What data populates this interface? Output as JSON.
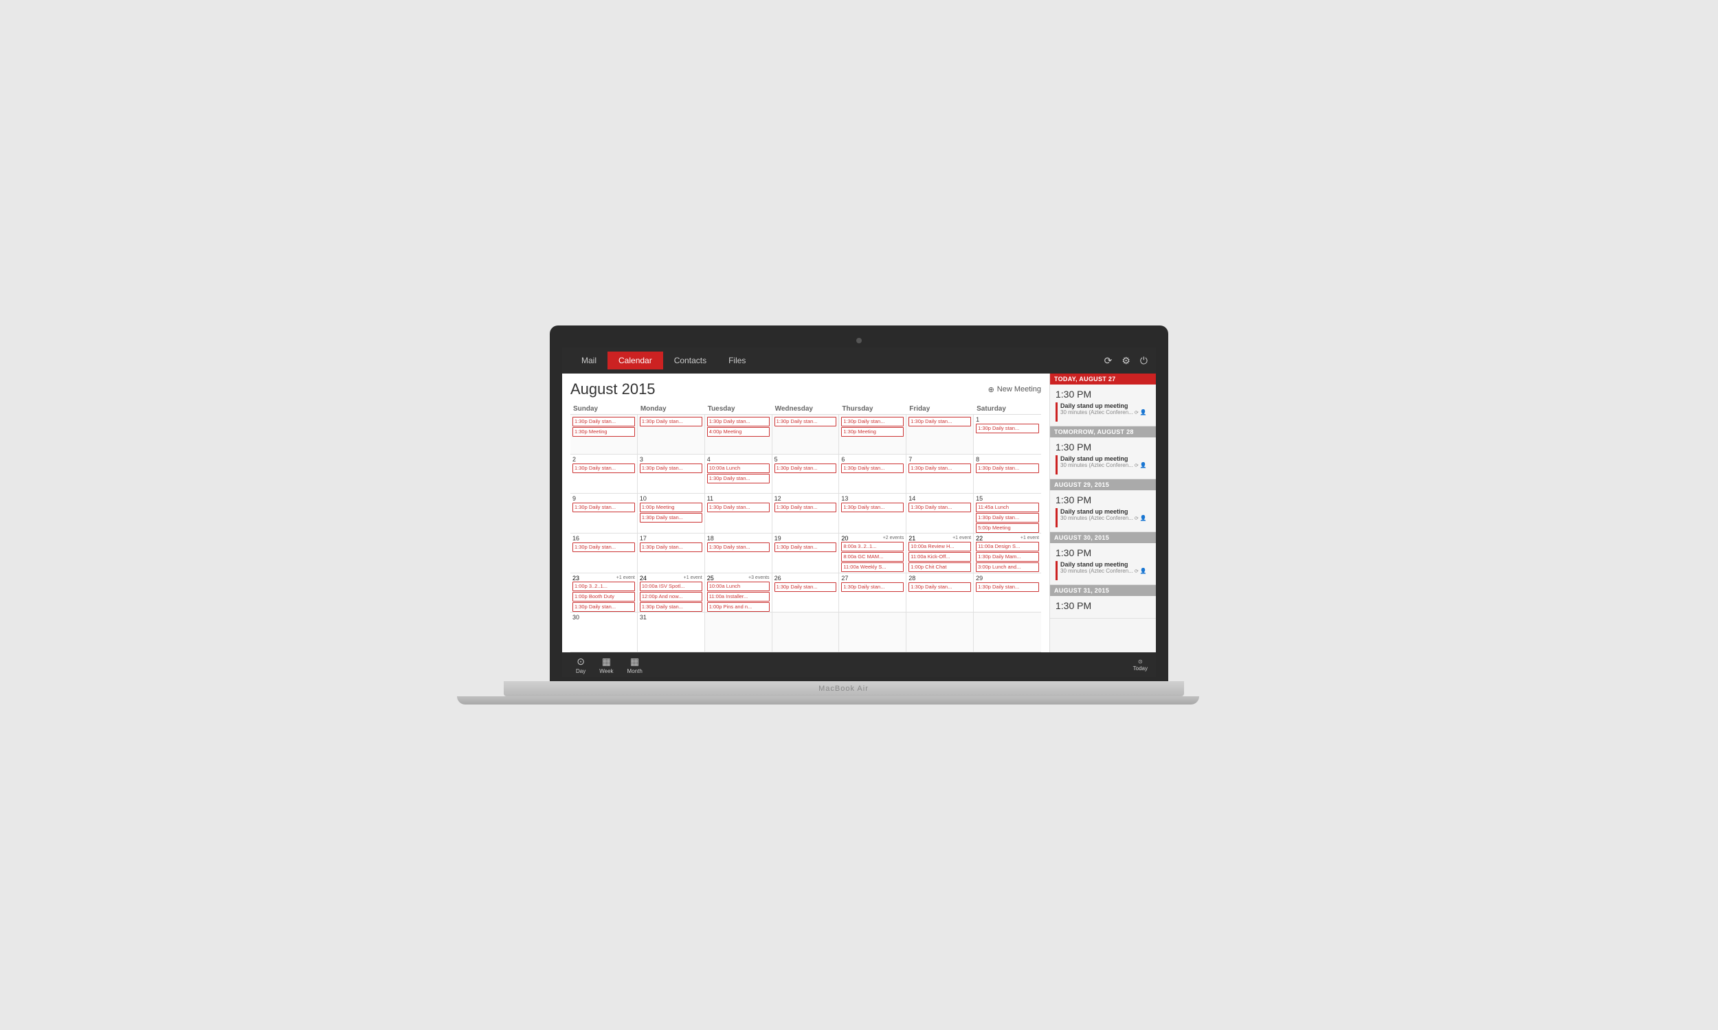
{
  "app": {
    "title": "MacBook Air"
  },
  "nav": {
    "tabs": [
      "Mail",
      "Calendar",
      "Contacts",
      "Files"
    ],
    "active_tab": "Calendar",
    "icons": [
      "refresh",
      "settings",
      "power"
    ]
  },
  "calendar": {
    "title": "August 2015",
    "new_meeting_label": "New Meeting",
    "day_headers": [
      "Sunday",
      "Monday",
      "Tuesday",
      "Wednesday",
      "Thursday",
      "Friday",
      "Saturday"
    ],
    "weeks": [
      [
        {
          "num": "",
          "events": []
        },
        {
          "num": "",
          "events": []
        },
        {
          "num": "",
          "events": []
        },
        {
          "num": "",
          "events": []
        },
        {
          "num": "",
          "events": []
        },
        {
          "num": "",
          "events": []
        },
        {
          "num": "1",
          "events": [
            "1:30p Daily stan..."
          ]
        }
      ],
      [
        {
          "num": "",
          "events": [
            "1:30p Daily stan..."
          ]
        },
        {
          "num": "3",
          "events": [
            "1:30p Daily stan..."
          ]
        },
        {
          "num": "4",
          "events": [
            "10:00a Lunch",
            "1:30p Daily stan..."
          ]
        },
        {
          "num": "5",
          "events": [
            "1:30p Daily stan..."
          ]
        },
        {
          "num": "6",
          "events": [
            "1:30p Daily stan..."
          ]
        },
        {
          "num": "7",
          "events": [
            "1:30p Daily stan..."
          ]
        },
        {
          "num": "8",
          "events": [
            "1:30p Daily stan..."
          ]
        }
      ],
      [
        {
          "num": "9",
          "events": [
            "1:30p Daily stan..."
          ]
        },
        {
          "num": "10",
          "events": [
            "1:00p Meeting",
            "1:30p Daily stan..."
          ]
        },
        {
          "num": "11",
          "events": [
            "1:30p Daily stan..."
          ]
        },
        {
          "num": "12",
          "events": [
            "1:30p Daily stan..."
          ]
        },
        {
          "num": "13",
          "events": [
            "1:30p Daily stan..."
          ]
        },
        {
          "num": "14",
          "events": [
            "1:30p Daily stan..."
          ]
        },
        {
          "num": "15",
          "events": [
            "11:45a Lunch",
            "1:30p Daily stan...",
            "5:00p Meeting"
          ]
        }
      ],
      [
        {
          "num": "16",
          "events": [
            "1:30p Daily stan..."
          ]
        },
        {
          "num": "17",
          "events": [
            "1:30p Daily stan..."
          ]
        },
        {
          "num": "18",
          "events": [
            "1:30p Daily stan..."
          ]
        },
        {
          "num": "19",
          "events": [
            "1:30p Daily stan..."
          ]
        },
        {
          "num": "20",
          "more": "+2 events",
          "events": [
            "8:00a 3..2..1...",
            "8:00a GC MAM...",
            "11:00a Weekly S..."
          ]
        },
        {
          "num": "21",
          "more": "+1 event",
          "events": [
            "10:00a Review H...",
            "11:00a Kick-Off...",
            "1:00p Chit Chat"
          ]
        },
        {
          "num": "22",
          "more": "+1 event",
          "events": [
            "11:00a Design S...",
            "1:30p Daily Mam...",
            "3:00p Lunch and..."
          ]
        }
      ],
      [
        {
          "num": "23",
          "more": "+1 event",
          "events": [
            "1:00p 3..2..1..."
          ]
        },
        {
          "num": "24",
          "more": "+1 event",
          "events": [
            "10:00a ISV Spotl...",
            "12:00p And now...",
            "1:30p Daily stan..."
          ]
        },
        {
          "num": "25",
          "more": "+3 events",
          "events": [
            "10:00a Lunch",
            "11:00a Installer...",
            "1:00p Pins and n..."
          ]
        },
        {
          "num": "26",
          "events": [
            "1:30p Daily stan..."
          ]
        },
        {
          "num": "27",
          "today": true,
          "events": [
            "1:30p Daily stan..."
          ]
        },
        {
          "num": "28",
          "events": [
            "1:30p Daily stan..."
          ]
        },
        {
          "num": "29",
          "events": [
            "1:30p Daily stan..."
          ]
        }
      ],
      [
        {
          "num": "30",
          "events": []
        },
        {
          "num": "31",
          "events": []
        },
        {
          "num": "",
          "events": []
        },
        {
          "num": "",
          "events": []
        },
        {
          "num": "",
          "events": []
        },
        {
          "num": "",
          "events": []
        },
        {
          "num": "",
          "events": []
        }
      ]
    ],
    "week1_extra": [
      {
        "num": "",
        "events": [
          "1:30p Daily stan...",
          "1:30p Meeting"
        ]
      },
      {
        "num": "",
        "events": [
          "1:30p Daily stan..."
        ]
      },
      {
        "num": "",
        "events": [
          "1:30p Daily stan...",
          "4:00p Meeting"
        ]
      },
      {
        "num": "",
        "events": [
          "1:30p Daily stan..."
        ]
      },
      {
        "num": "",
        "events": [
          "1:30p Daily stan...",
          "1:30p Meeting"
        ]
      },
      {
        "num": "",
        "events": [
          "1:30p Daily stan..."
        ]
      },
      {
        "num": "1",
        "events": [
          "1:30p Daily stan..."
        ]
      }
    ]
  },
  "sidebar": {
    "sections": [
      {
        "header": "TODAY, AUGUST 27",
        "header_type": "red",
        "time": "1:30 PM",
        "event_title": "Daily stand up meeting",
        "event_sub": "30 minutes (Aztec Conferen...",
        "has_sync": true
      },
      {
        "header": "TOMORROW, AUGUST 28",
        "header_type": "gray",
        "time": "1:30 PM",
        "event_title": "Daily stand up meeting",
        "event_sub": "30 minutes (Aztec Conferen...",
        "has_sync": true
      },
      {
        "header": "AUGUST 29, 2015",
        "header_type": "gray",
        "time": "1:30 PM",
        "event_title": "Daily stand up meeting",
        "event_sub": "30 minutes (Aztec Conferen...",
        "has_sync": true
      },
      {
        "header": "AUGUST 30, 2015",
        "header_type": "gray",
        "time": "1:30 PM",
        "event_title": "Daily stand up meeting",
        "event_sub": "30 minutes (Aztec Conferen...",
        "has_sync": true
      },
      {
        "header": "AUGUST 31, 2015",
        "header_type": "gray",
        "time": "1:30 PM",
        "event_title": "",
        "event_sub": "",
        "has_sync": false
      }
    ]
  },
  "bottom_bar": {
    "nav_items": [
      {
        "label": "Day",
        "icon": "⊙"
      },
      {
        "label": "Week",
        "icon": "▦"
      },
      {
        "label": "Month",
        "icon": "▦"
      }
    ],
    "today_label": "Today",
    "today_icon": "⊙"
  }
}
